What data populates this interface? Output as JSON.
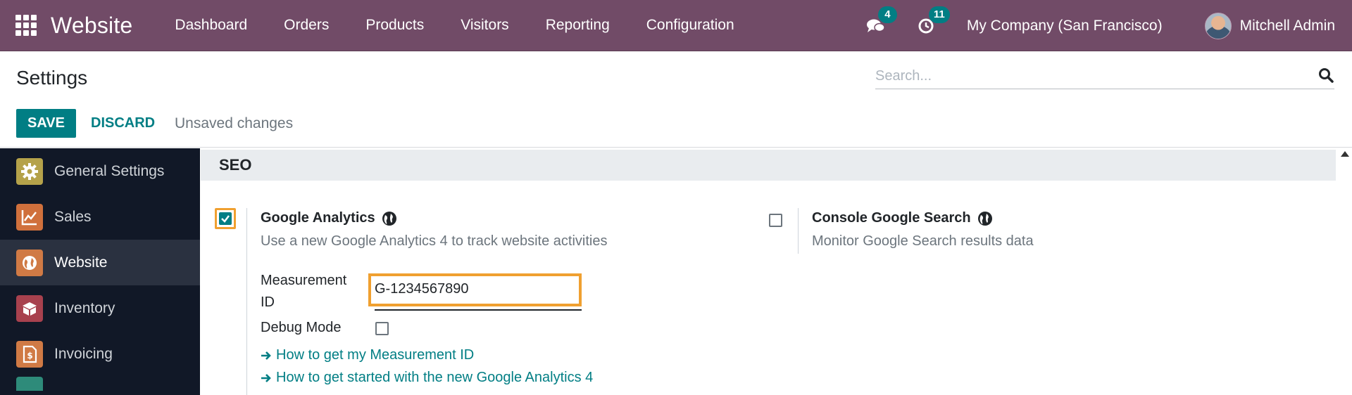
{
  "navbar": {
    "brand": "Website",
    "menu": [
      "Dashboard",
      "Orders",
      "Products",
      "Visitors",
      "Reporting",
      "Configuration"
    ],
    "messages_count": "4",
    "activities_count": "11",
    "company": "My Company (San Francisco)",
    "user": "Mitchell Admin",
    "color": "#714b67"
  },
  "control": {
    "title": "Settings",
    "search_placeholder": "Search...",
    "save_label": "SAVE",
    "discard_label": "DISCARD",
    "status": "Unsaved changes",
    "accent_color": "#017e84"
  },
  "sidebar": {
    "items": [
      {
        "label": "General Settings",
        "icon": "gear-icon",
        "active": false
      },
      {
        "label": "Sales",
        "icon": "chart-icon",
        "active": false
      },
      {
        "label": "Website",
        "icon": "globe-icon",
        "active": true
      },
      {
        "label": "Inventory",
        "icon": "box-icon",
        "active": false
      },
      {
        "label": "Invoicing",
        "icon": "invoice-icon",
        "active": false
      }
    ]
  },
  "main": {
    "section": "SEO",
    "google_analytics": {
      "title": "Google Analytics",
      "description": "Use a new Google Analytics 4 to track website activities",
      "checked": true,
      "measurement_label": "Measurement ID",
      "measurement_value": "G-1234567890",
      "debug_label": "Debug Mode",
      "debug_checked": false,
      "link1": "How to get my Measurement ID",
      "link2": "How to get started with the new Google Analytics 4"
    },
    "console_search": {
      "title": "Console Google Search",
      "description": "Monitor Google Search results data",
      "checked": false
    }
  }
}
